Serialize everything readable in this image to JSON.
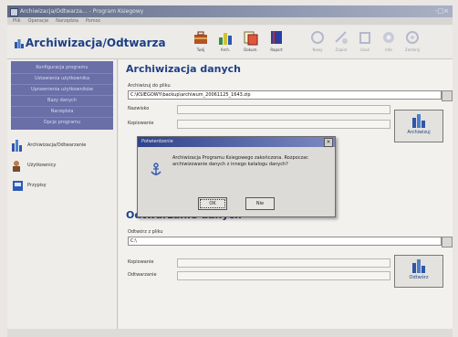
{
  "window": {
    "title": "Archiwizacja/Odtwarza... - Program Ksiegowy",
    "controls": "-□×"
  },
  "menu": [
    "Plik",
    "Operacje",
    "Narzędzia",
    "Pomoc"
  ],
  "app": {
    "logo_text": "Archiwizacja/Odtwarza"
  },
  "toolbar": {
    "buttons": [
      {
        "label": "Twój",
        "icon": "briefcase-icon"
      },
      {
        "label": "Arch.",
        "icon": "chart-icon"
      },
      {
        "label": "Dokum.",
        "icon": "documents-icon"
      },
      {
        "label": "Raport",
        "icon": "book-icon"
      },
      {
        "label": "Nowy",
        "icon": "new-icon"
      },
      {
        "label": "Zapisz",
        "icon": "save-icon"
      },
      {
        "label": "Usuń",
        "icon": "delete-icon"
      },
      {
        "label": "Info",
        "icon": "info-icon"
      },
      {
        "label": "Zamknij",
        "icon": "close-icon"
      }
    ]
  },
  "sidebar": {
    "nav_items": [
      "Konfiguracja programu",
      "Ustawienia użytkownika",
      "Uprawnienia użytkowników",
      "Bazy danych",
      "Narzędzia",
      "Opcje programu"
    ],
    "list_items": [
      {
        "label": "Archiwizacja/Odtwarzanie",
        "icon": "archive-icon"
      },
      {
        "label": "Użytkownicy",
        "icon": "users-icon"
      },
      {
        "label": "Przypisy",
        "icon": "disk-icon"
      }
    ]
  },
  "archive": {
    "heading": "Archiwizacja danych",
    "path_label": "Archiwizuj do pliku",
    "path_value": "C:\\KSIEGOWY\\backup\\archiwum_20061125_1643.zip",
    "password_label": "Nazwisko",
    "repeat_label": "Kopiowanie",
    "button_label": "Archiwizuj"
  },
  "dialog": {
    "title": "Potwierdzenie",
    "message": "Archiwizacja Programu Ksiegowego zakończona. Rozpoczac archiwizowanie danych z innego katalogu danych?",
    "ok_label": "OK",
    "cancel_label": "Nie"
  },
  "restore": {
    "heading": "Odtwarzanie danych",
    "path_label": "Odtwórz z pliku",
    "path_value": "C:\\",
    "repeat_label": "Kopiowanie",
    "password_label": "Odtwarzanie",
    "button_label": "Odtwórz"
  },
  "colors": {
    "brand": "#1f3f86",
    "nav": "#6a6fa8",
    "titlebar": "#5f6a86"
  }
}
